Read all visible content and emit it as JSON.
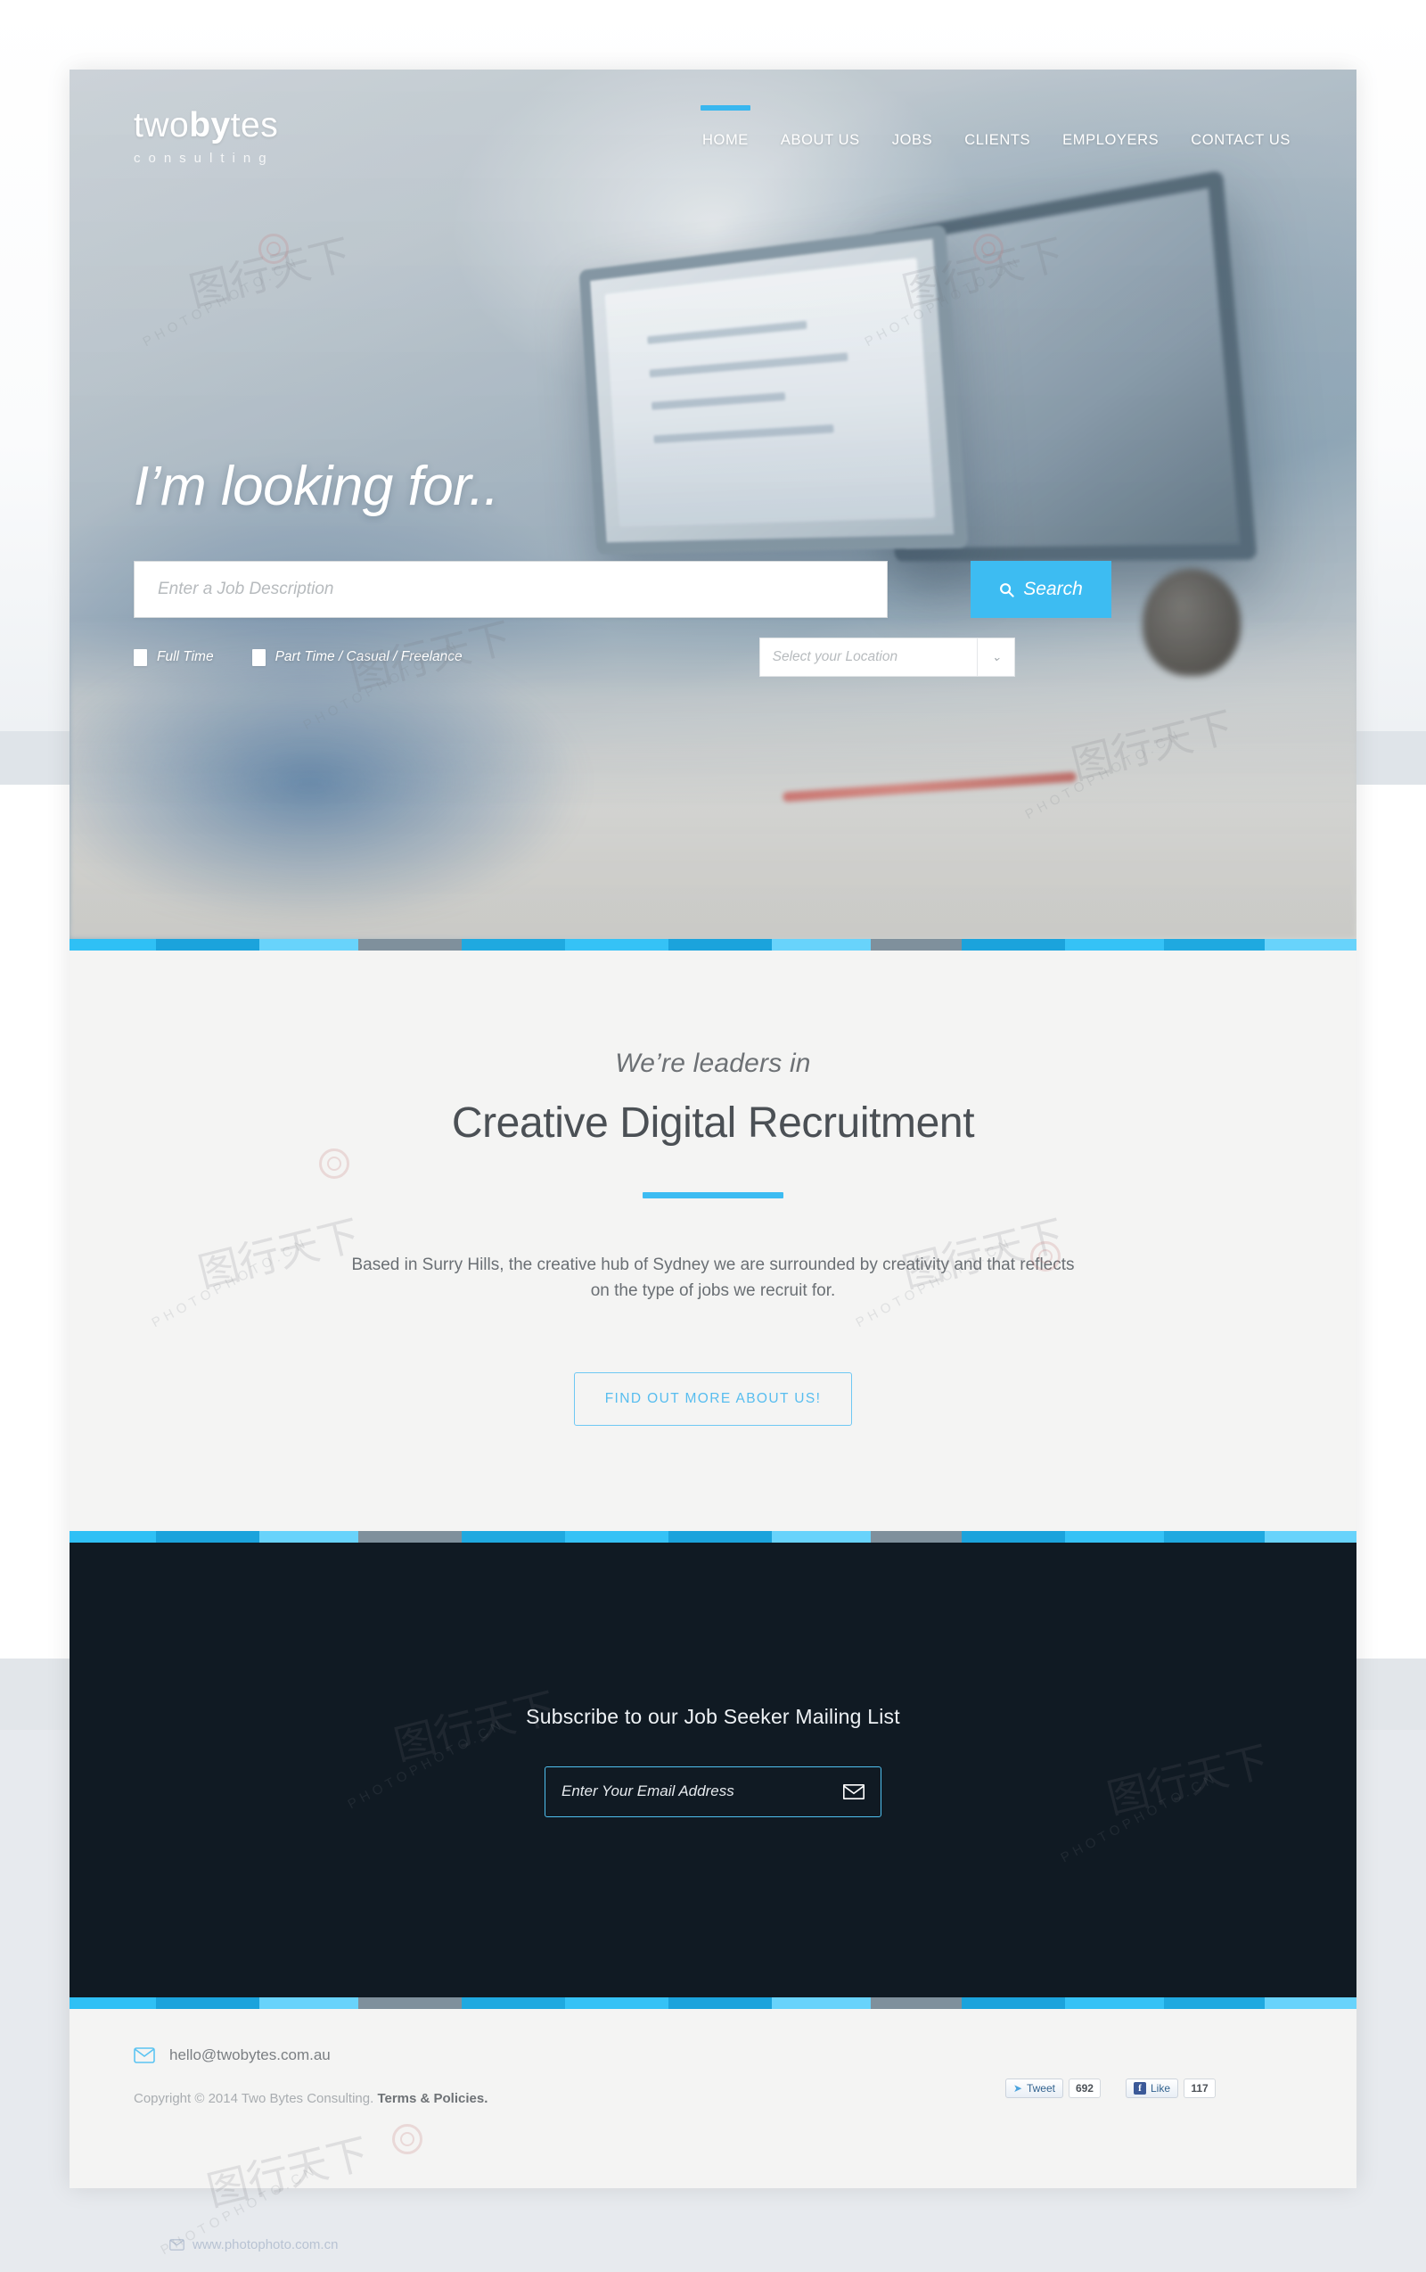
{
  "brand": {
    "logo_prefix": "two",
    "logo_bold": "by",
    "logo_suffix": "tes",
    "logo_tagline": "consulting"
  },
  "nav": {
    "items": [
      {
        "label": "HOME",
        "active": true
      },
      {
        "label": "ABOUT US",
        "active": false
      },
      {
        "label": "JOBS",
        "active": false
      },
      {
        "label": "CLIENTS",
        "active": false
      },
      {
        "label": "EMPLOYERS",
        "active": false
      },
      {
        "label": "CONTACT US",
        "active": false
      }
    ]
  },
  "hero": {
    "title": "I’m looking for..",
    "search_placeholder": "Enter a Job Description",
    "search_value": "",
    "search_button": "Search",
    "filters": [
      {
        "label": "Full Time",
        "checked": false
      },
      {
        "label": "Part Time / Casual / Freelance",
        "checked": false
      }
    ],
    "location_placeholder": "Select your Location",
    "location_value": "",
    "caret_glyph": "⌄"
  },
  "intro": {
    "eyebrow": "We’re leaders in",
    "headline": "Creative Digital Recruitment",
    "blurb": "Based in Surry Hills, the creative hub of Sydney we are surrounded by creativity and that reflects on the type of jobs we recruit for.",
    "cta_label": "FIND OUT MORE ABOUT US!"
  },
  "subscribe": {
    "title": "Subscribe to our Job Seeker Mailing List",
    "email_placeholder": "Enter Your Email Address",
    "email_value": ""
  },
  "footer": {
    "email": "hello@twobytes.com.au",
    "copyright": "Copyright © 2014 Two Bytes Consulting.",
    "terms_link": "Terms & Policies.",
    "social": {
      "tweet_label": "Tweet",
      "tweet_count": "692",
      "like_label": "Like",
      "like_count": "117",
      "facebook_glyph": "f",
      "twitter_glyph": "➤"
    }
  },
  "colors": {
    "accent_blue": "#3dbcf2",
    "accent_blue_light": "#6ad2fb",
    "accent_blue_dark": "#189fd8",
    "stripe_gray": "#7f909c",
    "dark_panel": "#101a23",
    "light_panel": "#f4f4f3"
  },
  "stripes": [
    {
      "color": "#2fc0f5",
      "w": 7.2
    },
    {
      "color": "#1ba3dc",
      "w": 8.6
    },
    {
      "color": "#68d3fb",
      "w": 8.2
    },
    {
      "color": "#7f909c",
      "w": 8.6
    },
    {
      "color": "#1fa9e0",
      "w": 8.6
    },
    {
      "color": "#35c2f6",
      "w": 8.6
    },
    {
      "color": "#1ba3dc",
      "w": 8.6
    },
    {
      "color": "#68d3fb",
      "w": 8.2
    },
    {
      "color": "#7f909c",
      "w": 7.6
    },
    {
      "color": "#1ba3dc",
      "w": 8.6
    },
    {
      "color": "#35c2f6",
      "w": 8.2
    },
    {
      "color": "#1fa9e0",
      "w": 8.4
    },
    {
      "color": "#68d3fb",
      "w": 7.6
    }
  ],
  "watermarks": {
    "text": "PHOTOPHOTO.CN",
    "site": "www.photophoto.com.cn"
  }
}
